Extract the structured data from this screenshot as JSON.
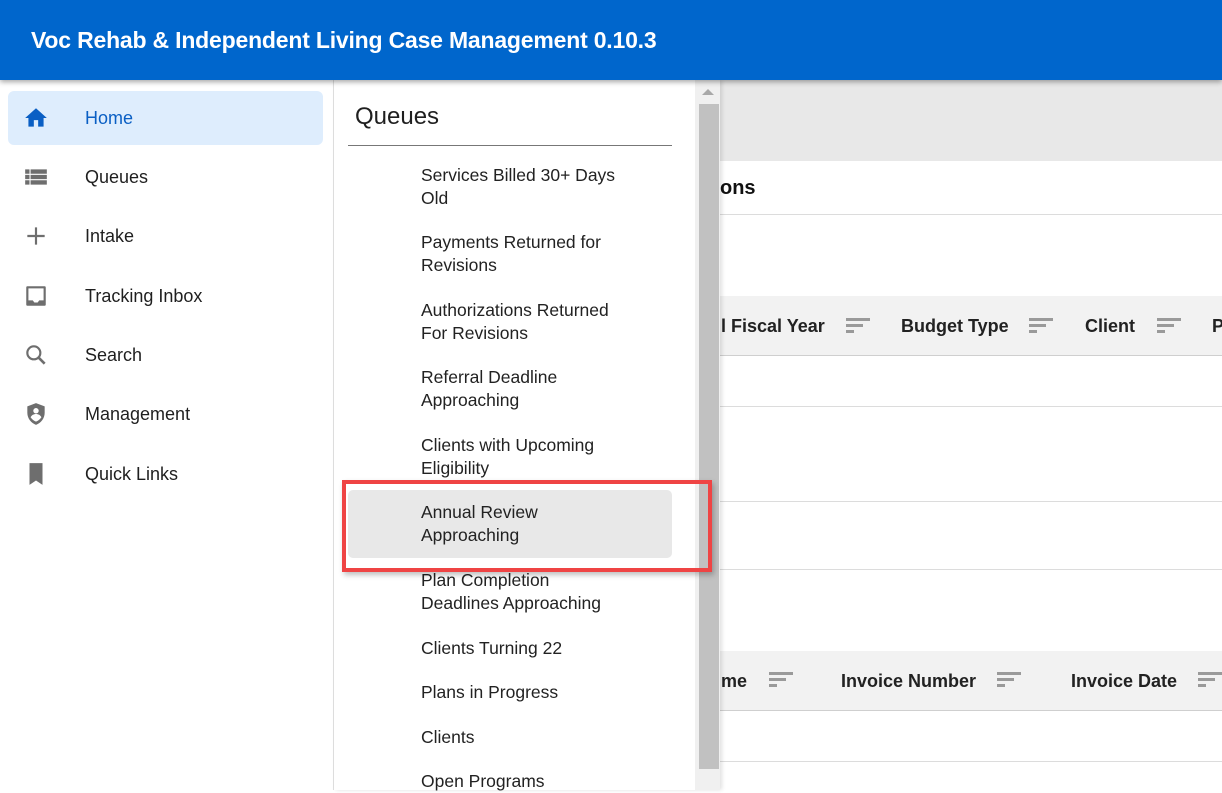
{
  "app": {
    "title": "Voc Rehab & Independent Living Case Management 0.10.3",
    "accent_color": "#0066cc"
  },
  "sidebar": {
    "items": [
      {
        "label": "Home",
        "icon": "home-icon",
        "active": true
      },
      {
        "label": "Queues",
        "icon": "list-icon",
        "active": false
      },
      {
        "label": "Intake",
        "icon": "plus-icon",
        "active": false
      },
      {
        "label": "Tracking Inbox",
        "icon": "inbox-icon",
        "active": false
      },
      {
        "label": "Search",
        "icon": "search-icon",
        "active": false
      },
      {
        "label": "Management",
        "icon": "shield-user-icon",
        "active": false
      },
      {
        "label": "Quick Links",
        "icon": "bookmark-icon",
        "active": false
      }
    ]
  },
  "queues_panel": {
    "title": "Queues",
    "items": [
      {
        "line1": "Services Billed 30+ Days",
        "line2": "Old"
      },
      {
        "line1": "Payments Returned for",
        "line2": "Revisions"
      },
      {
        "line1": "Authorizations Returned",
        "line2": "For Revisions"
      },
      {
        "line1": "Referral Deadline",
        "line2": "Approaching"
      },
      {
        "line1": "Clients with Upcoming",
        "line2": "Eligibility"
      },
      {
        "line1": "Annual Review",
        "line2": "Approaching",
        "highlighted": true
      },
      {
        "line1": "Plan Completion",
        "line2": "Deadlines Approaching"
      },
      {
        "line1": "Clients Turning 22",
        "line2": ""
      },
      {
        "line1": "Plans in Progress",
        "line2": ""
      },
      {
        "line1": "Clients",
        "line2": ""
      },
      {
        "line1": "Open Programs",
        "line2": ""
      }
    ]
  },
  "main": {
    "section_title_partial": "ons",
    "table1": {
      "headers": [
        "l Fiscal Year",
        "Budget Type",
        "Client",
        "P"
      ]
    },
    "table2": {
      "headers": [
        "me",
        "Invoice Number",
        "Invoice Date"
      ]
    }
  }
}
